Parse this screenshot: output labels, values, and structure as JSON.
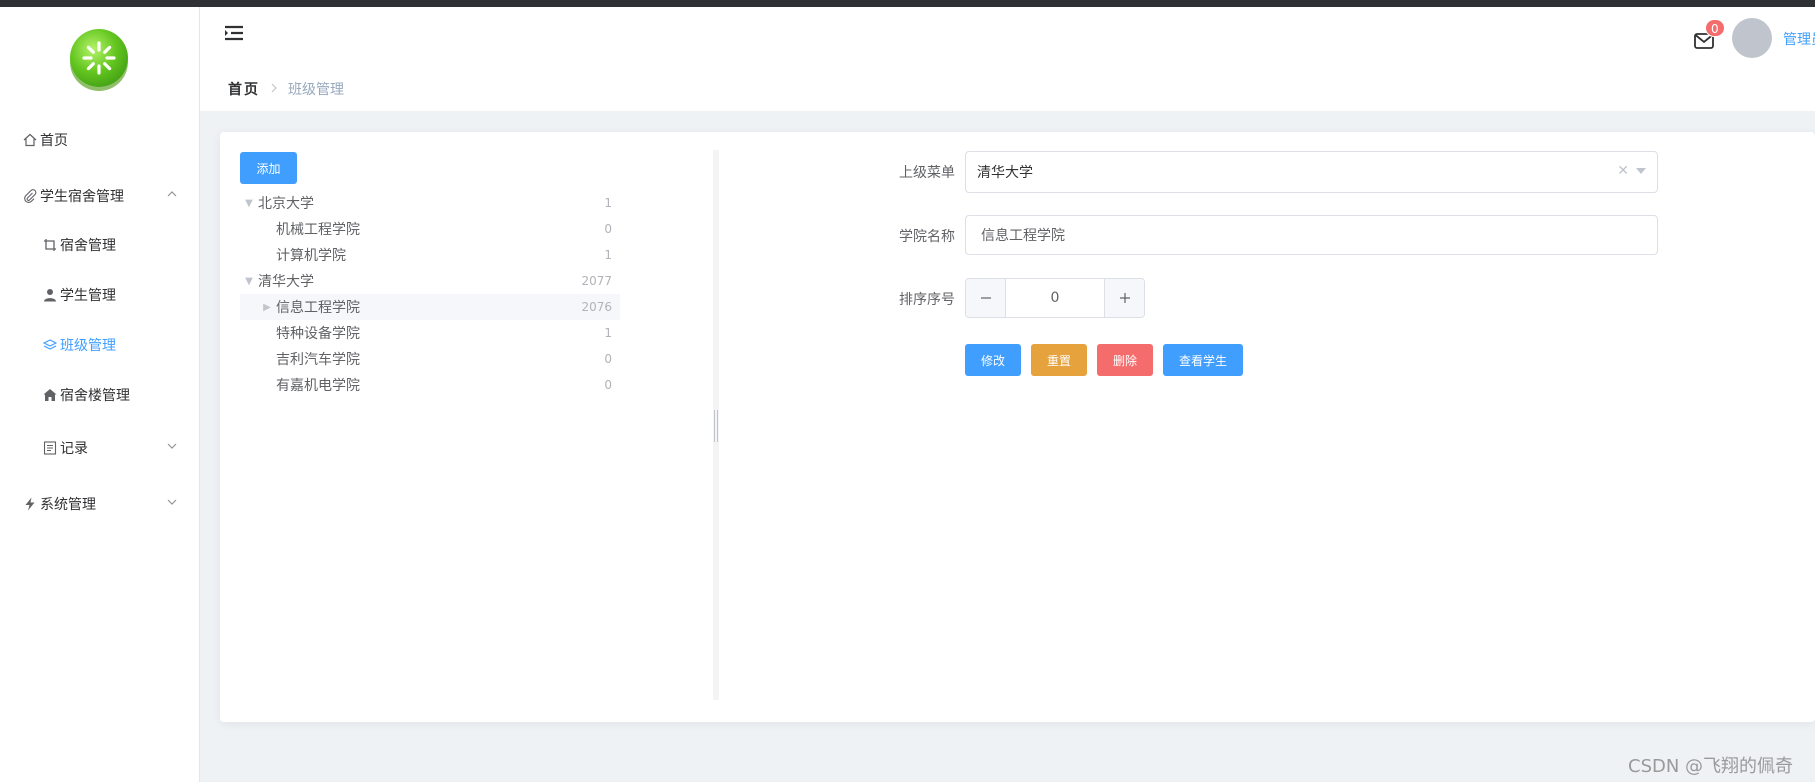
{
  "sidebar": {
    "items": [
      {
        "label": "首页",
        "icon": "home-icon"
      },
      {
        "label": "学生宿舍管理",
        "icon": "paperclip-icon"
      },
      {
        "label": "宿舍管理",
        "icon": "crop-icon"
      },
      {
        "label": "学生管理",
        "icon": "user-icon"
      },
      {
        "label": "班级管理",
        "icon": "layers-icon"
      },
      {
        "label": "宿舍楼管理",
        "icon": "house-icon"
      },
      {
        "label": "记录",
        "icon": "document-icon"
      },
      {
        "label": "系统管理",
        "icon": "lightning-icon"
      }
    ]
  },
  "header": {
    "breadcrumb": {
      "home": "首页",
      "current": "班级管理"
    },
    "mail_badge": "0",
    "username": "管理员"
  },
  "toolbar": {
    "add_label": "添加"
  },
  "tree": [
    {
      "label": "北京大学",
      "count": "1",
      "level": 0,
      "caret": "expanded"
    },
    {
      "label": "机械工程学院",
      "count": "0",
      "level": 1,
      "caret": "none"
    },
    {
      "label": "计算机学院",
      "count": "1",
      "level": 1,
      "caret": "none"
    },
    {
      "label": "清华大学",
      "count": "2077",
      "level": 0,
      "caret": "expanded"
    },
    {
      "label": "信息工程学院",
      "count": "2076",
      "level": 1,
      "caret": "collapsed",
      "selected": true
    },
    {
      "label": "特种设备学院",
      "count": "1",
      "level": 1,
      "caret": "none"
    },
    {
      "label": "吉利汽车学院",
      "count": "0",
      "level": 1,
      "caret": "none"
    },
    {
      "label": "有嘉机电学院",
      "count": "0",
      "level": 1,
      "caret": "none"
    }
  ],
  "form": {
    "parent_label": "上级菜单",
    "parent_value": "清华大学",
    "name_label": "学院名称",
    "name_value": "信息工程学院",
    "order_label": "排序序号",
    "order_value": "0"
  },
  "actions": {
    "edit": "修改",
    "reset": "重置",
    "delete": "删除",
    "view_students": "查看学生"
  },
  "colors": {
    "primary": "#409eff",
    "warning": "#e6a23c",
    "danger": "#f56c6c"
  },
  "watermark": "CSDN @飞翔的佩奇"
}
